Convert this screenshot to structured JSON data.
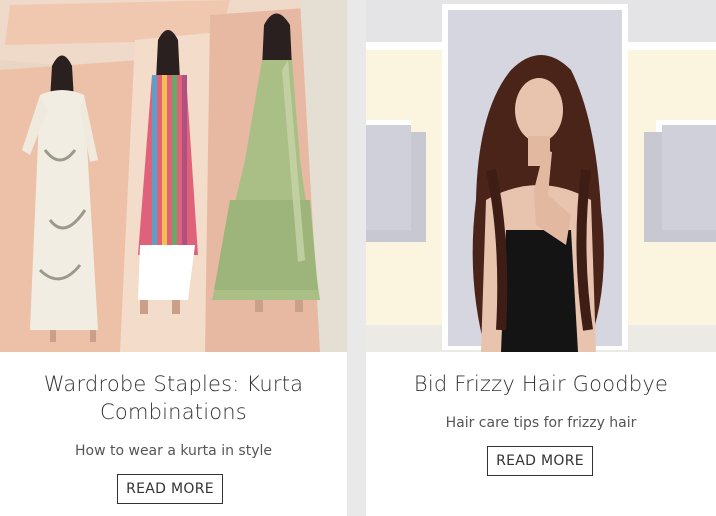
{
  "cards": [
    {
      "title": "Wardrobe Staples: Kurta Combinations",
      "subtitle": "How to wear a kurta in style",
      "button_label": "READ MORE",
      "image_alt": "three-models-wearing-kurtas"
    },
    {
      "title": "Bid Frizzy Hair Goodbye",
      "subtitle": "Hair care tips for frizzy hair",
      "button_label": "READ MORE",
      "image_alt": "woman-with-long-frizzy-hair"
    }
  ],
  "colors": {
    "page_bg": "#e9e9e9",
    "card_bg": "#ffffff",
    "text": "#333333",
    "left_image_bg": "#e6cbb5",
    "right_image_wall": "#fbf5df"
  }
}
